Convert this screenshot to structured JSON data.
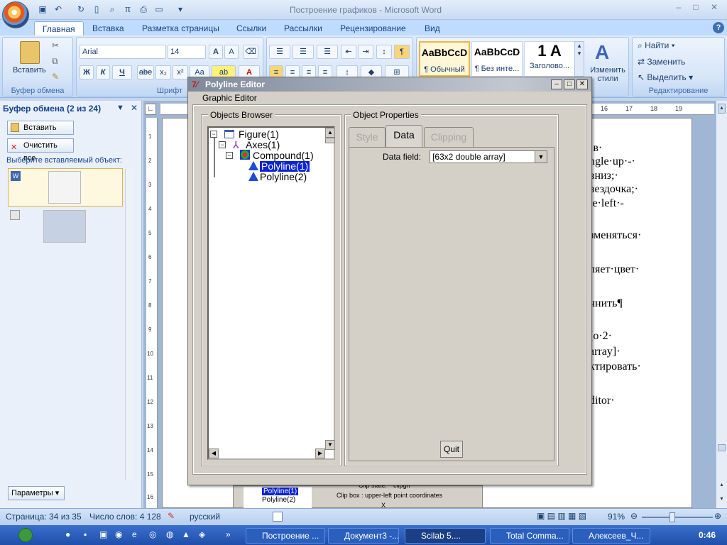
{
  "window": {
    "title": "Построение графиков - Microsoft Word",
    "controls": [
      "–",
      "□",
      "✕"
    ]
  },
  "qat": {
    "icons": [
      "save-icon",
      "undo-icon",
      "redo-icon",
      "new-doc-icon",
      "preview-icon",
      "pi-icon",
      "print-icon",
      "open-icon"
    ]
  },
  "ribbon": {
    "tabs": [
      "Главная",
      "Вставка",
      "Разметка страницы",
      "Ссылки",
      "Рассылки",
      "Рецензирование",
      "Вид"
    ],
    "active_tab": "Главная",
    "clipboard": {
      "paste_label": "Вставить",
      "group_label": "Буфер обмена"
    },
    "font": {
      "name": "Arial",
      "size": "14",
      "group_label": "Шрифт",
      "bold": "Ж",
      "italic": "К",
      "underline": "Ч",
      "strike": "abe",
      "sub": "x₂",
      "sup": "x²",
      "case": "Aa"
    },
    "styles": [
      {
        "sample": "AaBbCcD",
        "name": "¶ Обычный"
      },
      {
        "sample": "AaBbCcD",
        "name": "¶ Без инте..."
      },
      {
        "sample": "1 A",
        "name": "Заголово..."
      }
    ],
    "change_styles": "Изменить стили",
    "editing": {
      "find": "Найти",
      "replace": "Заменить",
      "select": "Выделить",
      "group_label": "Редактирование"
    }
  },
  "clipboard_pane": {
    "title": "Буфер обмена (2 из 24)",
    "paste_all": "Вставить все",
    "clear_all": "Очистить все",
    "prompt": "Выберите вставляемый объект:",
    "options": "Параметры"
  },
  "document": {
    "ruler_marks": [
      "16",
      "17",
      "18",
      "19"
    ],
    "vertical_marks": [
      "1",
      "2",
      "3",
      "4",
      "5",
      "6",
      "7",
      "8",
      "9",
      "10",
      "11",
      "12",
      "13",
      "14",
      "15",
      "16",
      "17"
    ],
    "lines": [
      "·в·",
      "ngle·up·-·",
      "вниз;·",
      "вездочка;·",
      "le·left·-",
      "зменяться·",
      "ляет·цвет·",
      "чнить¶",
      "[о·2·",
      "array]·",
      "ктировать·",
      "ditor·"
    ]
  },
  "status": {
    "page": "Страница: 34 из 35",
    "words": "Число слов: 4 128",
    "lang": "русский",
    "zoom": "91%"
  },
  "taskbar": {
    "tasks": [
      "Построение ...",
      "Документ3 -...",
      "Scilab 5....",
      "Total Comma...",
      "Алексеев_Ч..."
    ],
    "clock": "0:46"
  },
  "dialog": {
    "title": "Polyline Editor",
    "menu": "Graphic Editor",
    "objects_browser": "Objects Browser",
    "object_properties": "Object Properties",
    "tree": [
      {
        "label": "Figure(1)",
        "level": 0,
        "selected": false
      },
      {
        "label": "Axes(1)",
        "level": 1,
        "selected": false
      },
      {
        "label": "Compound(1)",
        "level": 2,
        "selected": false
      },
      {
        "label": "Polyline(1)",
        "level": 3,
        "selected": true
      },
      {
        "label": "Polyline(2)",
        "level": 3,
        "selected": false
      }
    ],
    "tabs": [
      "Style",
      "Data",
      "Clipping"
    ],
    "active_tab": "Data",
    "data_field_label": "Data field:",
    "data_field_value": "[63x2 double array]",
    "quit": "Quit"
  },
  "behind": {
    "polyline1": "Polyline(1)",
    "polyline2": "Polyline(2)",
    "clip_state": "Clip state:",
    "clip_state_value": "clipgrf",
    "clip_box": "Clip box : upper-left point coordinates",
    "x_label": "X"
  }
}
